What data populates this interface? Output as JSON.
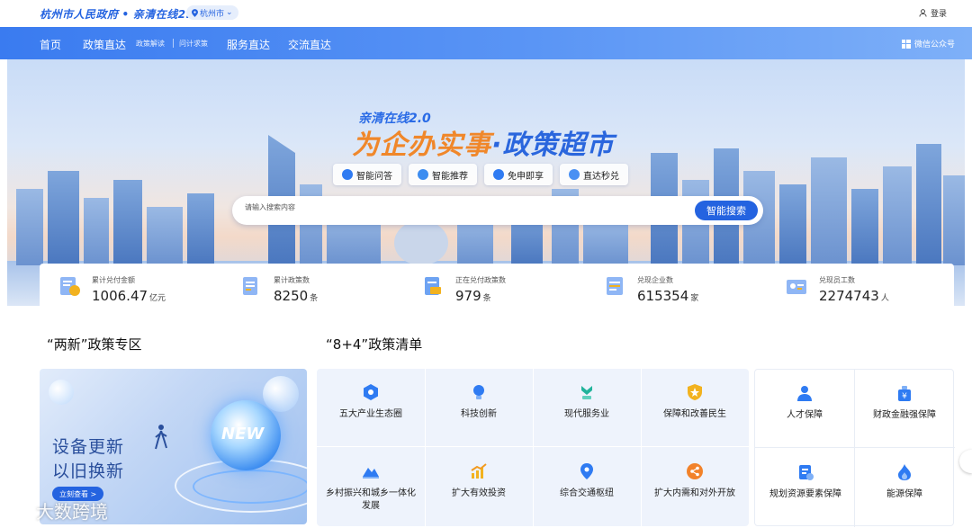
{
  "header": {
    "brand_main": "杭州市人民政府",
    "brand_dot": "•",
    "brand_sub": "亲清在线2.0",
    "city": "杭州市",
    "login": "登录"
  },
  "nav": {
    "items": [
      "首页",
      "政策直达",
      "服务直达",
      "交流直达"
    ],
    "sub_items": [
      "政策解读",
      "问计求策"
    ],
    "wechat": "微信公众号"
  },
  "hero": {
    "subtitle": "亲清在线2.0",
    "title_a": "为企办实事",
    "title_dot": "·",
    "title_b": "政策超市",
    "chips": [
      "智能问答",
      "智能推荐",
      "免申即享",
      "直达秒兑"
    ],
    "search_placeholder": "请输入搜索内容",
    "search_button": "智能搜索"
  },
  "stats": [
    {
      "label": "累计兑付金额",
      "value": "1006.47",
      "unit": "亿元",
      "icon": "money-doc-icon"
    },
    {
      "label": "累计政策数",
      "value": "8250",
      "unit": "条",
      "icon": "policy-book-icon"
    },
    {
      "label": "正在兑付政策数",
      "value": "979",
      "unit": "条",
      "icon": "paying-doc-icon"
    },
    {
      "label": "兑现企业数",
      "value": "615354",
      "unit": "家",
      "icon": "enterprise-doc-icon"
    },
    {
      "label": "兑现员工数",
      "value": "2274743",
      "unit": "人",
      "icon": "employee-card-icon"
    }
  ],
  "sections": {
    "left_title": "“两新”政策专区",
    "right_title": "“8+4”政策清单"
  },
  "promo": {
    "line1": "设备更新",
    "line2": "以旧换新",
    "button": "立刻查看 >",
    "badge": "NEW"
  },
  "policy8": [
    {
      "label": "五大产业生态圈",
      "icon": "hexagon-icon",
      "color": "#2f7bf2"
    },
    {
      "label": "科技创新",
      "icon": "bulb-icon",
      "color": "#2f7bf2"
    },
    {
      "label": "现代服务业",
      "icon": "service-hand-icon",
      "color": "#21b39b"
    },
    {
      "label": "保障和改善民生",
      "icon": "shield-icon",
      "color": "#f2b21f"
    },
    {
      "label": "乡村振兴和城乡一体化发展",
      "icon": "mountain-icon",
      "color": "#2f7bf2"
    },
    {
      "label": "扩大有效投资",
      "icon": "chart-up-icon",
      "color": "#f2b21f"
    },
    {
      "label": "综合交通枢纽",
      "icon": "location-pin-icon",
      "color": "#2f7bf2"
    },
    {
      "label": "扩大内需和对外开放",
      "icon": "share-circle-icon",
      "color": "#f2822a"
    }
  ],
  "policy4": [
    {
      "label": "人才保障",
      "icon": "person-icon",
      "color": "#2f7bf2"
    },
    {
      "label": "财政金融强保障",
      "icon": "finance-bag-icon",
      "color": "#2f7bf2"
    },
    {
      "label": "规划资源要素保障",
      "icon": "plan-doc-icon",
      "color": "#2f7bf2"
    },
    {
      "label": "能源保障",
      "icon": "flame-icon",
      "color": "#2f7bf2"
    }
  ],
  "watermark": "大数跨境"
}
